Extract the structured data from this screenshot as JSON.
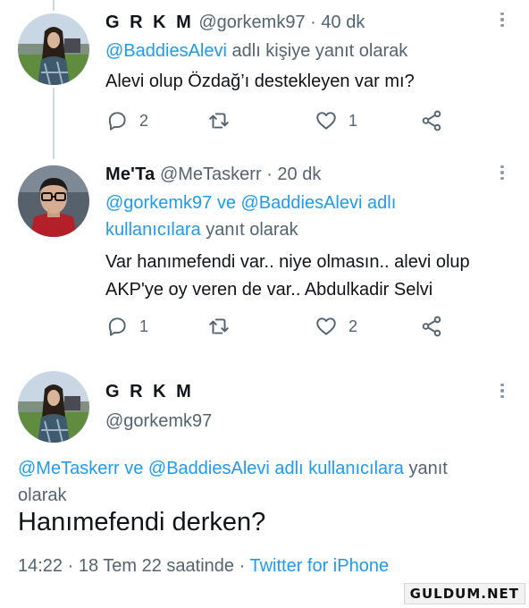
{
  "tweets": [
    {
      "name": "G R K M",
      "handle": "@gorkemk97",
      "separator": "·",
      "time": "40 dk",
      "reply_mentions": [
        "@BaddiesAlevi"
      ],
      "reply_suffix": "adlı kişiye yanıt olarak",
      "text": "Alevi olup Özdağ’ı destekleyen var mı?",
      "counts": {
        "replies": "2",
        "retweets": "",
        "likes": "1"
      }
    },
    {
      "name": "Me'Ta",
      "handle": "@MeTaskerr",
      "separator": "·",
      "time": "20 dk",
      "reply_mention_1": "@gorkemk97",
      "reply_and_1": "ve",
      "reply_mention_2": "@BaddiesAlevi",
      "reply_mid": "adlı",
      "reply_mention_3": "kullanıcılara",
      "reply_suffix": "yanıt olarak",
      "text_line1": "Var hanımefendi var.. niye olmasın.. alevi olup",
      "text_line2": "AKP'ye oy veren de var.. Abdulkadir Selvi",
      "counts": {
        "replies": "1",
        "retweets": "",
        "likes": "2"
      }
    }
  ],
  "main_tweet": {
    "name": "G R K M",
    "handle": "@gorkemk97",
    "reply_mention_1": "@MeTaskerr",
    "reply_and": "ve",
    "reply_mention_2": "@BaddiesAlevi adlı kullanıcılara",
    "reply_suffix_1": "yanıt",
    "reply_suffix_2": "olarak",
    "text": "Hanımefendi derken?",
    "time": "14:22 · 18 Tem 22 saatinde ·",
    "source": "Twitter for iPhone"
  },
  "watermark": "GULDUM.NET",
  "icons": {
    "reply": "reply-icon",
    "retweet": "retweet-icon",
    "like": "heart-icon",
    "share": "share-icon",
    "more": "more-vertical-icon"
  },
  "colors": {
    "accent": "#1d9bf0",
    "secondary_text": "#536471",
    "primary_text": "#0f1419",
    "thread_line": "#cfd9de"
  }
}
